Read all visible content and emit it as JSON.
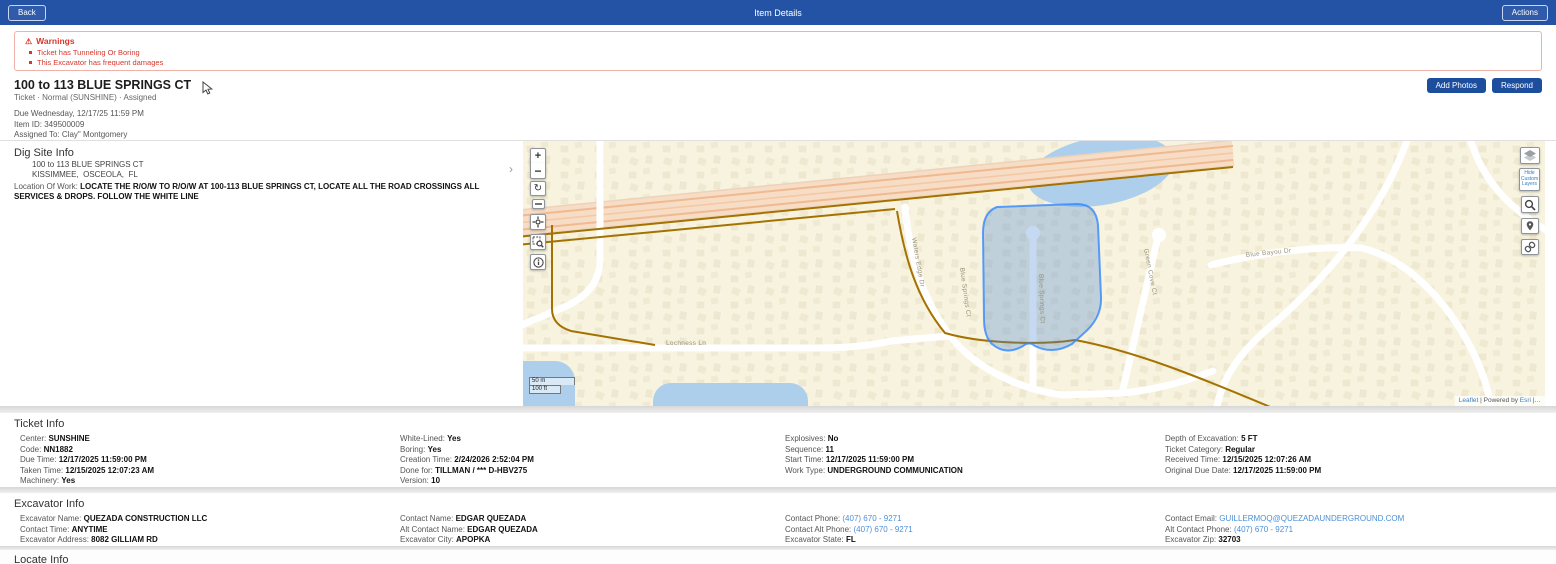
{
  "topbar": {
    "back_label": "Back",
    "title": "Item Details",
    "actions_label": "Actions"
  },
  "warnings": {
    "icon": "⚠",
    "title": "Warnings",
    "items": [
      "Ticket has Tunneling Or Boring",
      "This Excavator has frequent damages"
    ]
  },
  "summary": {
    "title": "100 to 113 BLUE SPRINGS CT",
    "status_line": "Ticket · Normal (SUNSHINE) · Assigned",
    "due_line": "Due Wednesday, 12/17/25 11:59 PM",
    "item_id_line": "Item ID: 349500009",
    "assigned_line": "Assigned To: Clay\" Montgomery",
    "add_photos_label": "Add Photos",
    "respond_label": "Respond"
  },
  "dig_site": {
    "heading": "Dig Site Info",
    "address_line1": "100 to 113 BLUE SPRINGS CT",
    "address_line2": "KISSIMMEE,  OSCEOLA,  FL",
    "location_label": "Location Of Work:",
    "location_value": "LOCATE THE R/O/W TO R/O/W AT 100-113 BLUE SPRINGS CT, LOCATE ALL THE ROAD CROSSINGS ALL SERVICES & DROPS. FOLLOW THE WHITE LINE",
    "chevron": "›"
  },
  "map": {
    "zoom_in": "+",
    "zoom_out": "−",
    "reset": "↻",
    "hide_custom_layers_label": "Hide Custom Layers",
    "scale_metric": "50 m",
    "scale_imperial": "100 ft",
    "attribution_leaflet": "Leaflet",
    "attribution_middle": "| Powered by",
    "attribution_esri": "Esri",
    "attribution_tail": "|…",
    "street_labels": {
      "waters_edge": "Waters Edge Dr",
      "blue_springs_west": "Blue Springs Ct",
      "blue_springs_center": "Blue Springs Ct",
      "green_cove": "Green Cove Ct",
      "lochness": "Lochness Ln",
      "blue_bayou": "Blue Bayou Dr"
    },
    "highlight_color": "#3388ff"
  },
  "ticket_info": {
    "heading": "Ticket Info",
    "col1": [
      {
        "label": "Center:",
        "value": "SUNSHINE"
      },
      {
        "label": "Code:",
        "value": "NN1882"
      },
      {
        "label": "Due Time:",
        "value": "12/17/2025 11:59:00 PM"
      },
      {
        "label": "Taken Time:",
        "value": "12/15/2025 12:07:23 AM"
      },
      {
        "label": "Machinery:",
        "value": "Yes"
      }
    ],
    "col2": [
      {
        "label": "White-Lined:",
        "value": "Yes"
      },
      {
        "label": "Boring:",
        "value": "Yes"
      },
      {
        "label": "Creation Time:",
        "value": "2/24/2026 2:52:04 PM"
      },
      {
        "label": "Done for:",
        "value": "TILLMAN / *** D-HBV275"
      },
      {
        "label": "Version:",
        "value": "10"
      }
    ],
    "col3": [
      {
        "label": "Explosives:",
        "value": "No"
      },
      {
        "label": "Sequence:",
        "value": "11"
      },
      {
        "label": "Start Time:",
        "value": "12/17/2025 11:59:00 PM"
      },
      {
        "label": "Work Type:",
        "value": "UNDERGROUND COMMUNICATION"
      }
    ],
    "col4": [
      {
        "label": "Depth of Excavation:",
        "value": "5 FT"
      },
      {
        "label": "Ticket Category:",
        "value": "Regular"
      },
      {
        "label": "Received Time:",
        "value": "12/15/2025 12:07:26 AM"
      },
      {
        "label": "Original Due Date:",
        "value": "12/17/2025 11:59:00 PM"
      }
    ]
  },
  "excavator_info": {
    "heading": "Excavator Info",
    "col1": [
      {
        "label": "Excavator Name:",
        "value": "QUEZADA CONSTRUCTION LLC"
      },
      {
        "label": "Contact Time:",
        "value": "ANYTIME"
      },
      {
        "label": "Excavator Address:",
        "value": "8082 GILLIAM RD"
      }
    ],
    "col2": [
      {
        "label": "Contact Name:",
        "value": "EDGAR QUEZADA"
      },
      {
        "label": "Alt Contact Name:",
        "value": "EDGAR QUEZADA"
      },
      {
        "label": "Excavator City:",
        "value": "APOPKA"
      }
    ],
    "col3": [
      {
        "label": "Contact Phone:",
        "value": "(407) 670 - 9271"
      },
      {
        "label": "Contact Alt Phone:",
        "value": "(407) 670 - 9271"
      },
      {
        "label": "Excavator State:",
        "value": "FL"
      }
    ],
    "col4": [
      {
        "label": "Contact Email:",
        "value": "GUILLERMOQ@QUEZADAUNDERGROUND.COM"
      },
      {
        "label": "Alt Contact Phone:",
        "value": "(407) 670 - 9271"
      },
      {
        "label": "Excavator Zip:",
        "value": "32703"
      }
    ]
  },
  "locate_info": {
    "heading": "Locate Info"
  }
}
